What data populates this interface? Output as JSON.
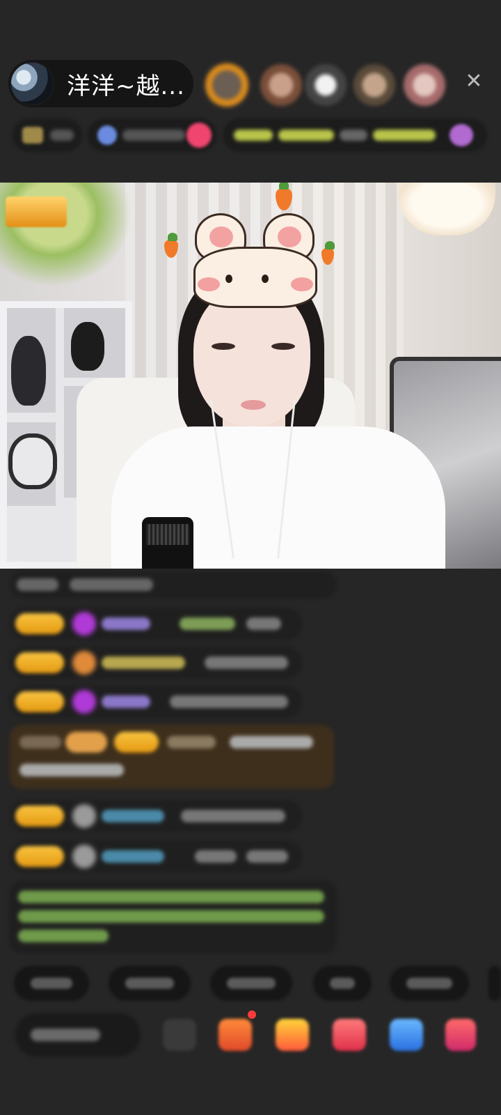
{
  "header": {
    "host_name": "洋洋~越...",
    "close_icon": "close-icon"
  },
  "overlays": {
    "video_badge_text": "",
    "sticker": "bunny-carrot-sticker"
  },
  "colors": {
    "background": "#262626",
    "badge_yellow": "#f8c440",
    "chat_bubble": "#1f1f1f"
  }
}
